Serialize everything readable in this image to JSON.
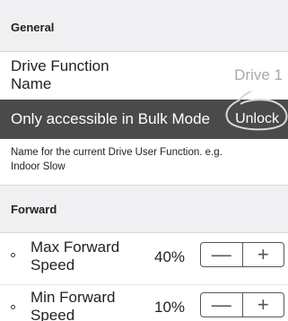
{
  "general": {
    "header": "General",
    "drive_function_name": {
      "label": "Drive Function Name",
      "value": "Drive 1"
    },
    "lock_bar": {
      "message": "Only accessible in Bulk Mode",
      "unlock_label": "Unlock"
    },
    "help_text": "Name for the current Drive User Function. e.g. Indoor Slow"
  },
  "forward": {
    "header": "Forward",
    "rows": [
      {
        "label": "Max Forward Speed",
        "value": "40%",
        "minus": "—",
        "plus": "+"
      },
      {
        "label": "Min Forward Speed",
        "value": "10%",
        "minus": "—",
        "plus": "+"
      }
    ]
  },
  "colors": {
    "lock_bar_bg": "#4a4a4a",
    "section_header_bg": "#f0f0f2",
    "value_gray": "#a8a8a8"
  },
  "icons": [
    "bullet-icon",
    "minus-icon",
    "plus-icon"
  ]
}
